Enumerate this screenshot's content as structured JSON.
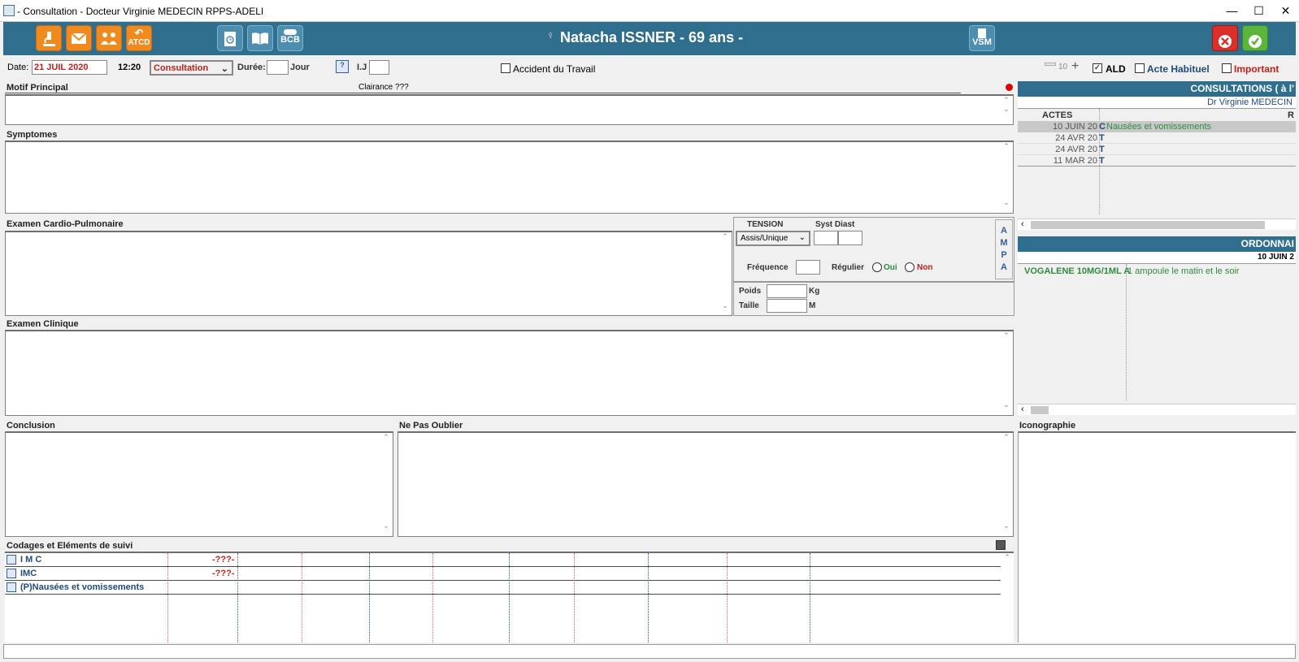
{
  "window": {
    "title": "- Consultation - Docteur Virginie MEDECIN RPPS-ADELI",
    "minimize": "—",
    "maximize": "☐",
    "close": "✕"
  },
  "toolbar": {
    "atcd_label": "ATCD",
    "bcb_label": "BCB",
    "vsm_label": "VSM",
    "patient_name": "Natacha ISSNER - 69 ans  -"
  },
  "form": {
    "date_label": "Date:",
    "date_value": "21 JUIL 2020",
    "time": "12:20",
    "type_value": "Consultation",
    "duree_label": "Durée:",
    "jour_label": "Jour",
    "ij_label": "I.J",
    "accident_label": "Accident du Travail",
    "zoom_value": "10",
    "ald_label": "ALD",
    "acte_habituel_label": "Acte Habituel",
    "important_label": "Important"
  },
  "sections": {
    "motif": "Motif Principal",
    "clairance": "Clairance ???",
    "symptomes": "Symptomes",
    "cardio": "Examen Cardio-Pulmonaire",
    "clinique": "Examen Clinique",
    "conclusion": "Conclusion",
    "ne_pas_oublier": "Ne Pas Oublier",
    "codages": "Codages et Eléments de suivi",
    "iconographie": "Iconographie"
  },
  "tension": {
    "title": "TENSION",
    "syst_diast": "Syst Diast",
    "position": "Assis/Unique",
    "frequence": "Fréquence",
    "regulier": "Régulier",
    "oui": "Oui",
    "non": "Non",
    "poids": "Poids",
    "kg": "Kg",
    "taille": "Taille",
    "m": "M",
    "ampa": [
      "A",
      "M",
      "P",
      "A"
    ]
  },
  "codages_rows": [
    {
      "label": "I M C",
      "value": "-???-"
    },
    {
      "label": "IMC",
      "value": "-???-"
    },
    {
      "label": "(P)Nausées et vomissements",
      "value": ""
    }
  ],
  "consultations": {
    "header": "CONSULTATIONS ( à l'",
    "doctor": "Dr Virginie MEDECIN",
    "col_actes": "ACTES",
    "col_r": "R",
    "rows": [
      {
        "date": "10 JUIN 20",
        "code": "C",
        "desc": "Nausées et vomissements"
      },
      {
        "date": "24 AVR 20",
        "code": "T",
        "desc": ""
      },
      {
        "date": "24 AVR 20",
        "code": "T",
        "desc": ""
      },
      {
        "date": "11 MAR 20",
        "code": "T",
        "desc": ""
      }
    ]
  },
  "ordonnances": {
    "header": "ORDONNAI",
    "date": "10 JUIN  2",
    "drug": "VOGALENE 10MG/1ML A",
    "posology": "1 ampoule le matin et le soir"
  },
  "colors": {
    "toolbar": "#2f6f8d",
    "accent_red": "#c0201b",
    "accent_green": "#2e8b3e",
    "link_blue": "#1f4a7a"
  }
}
